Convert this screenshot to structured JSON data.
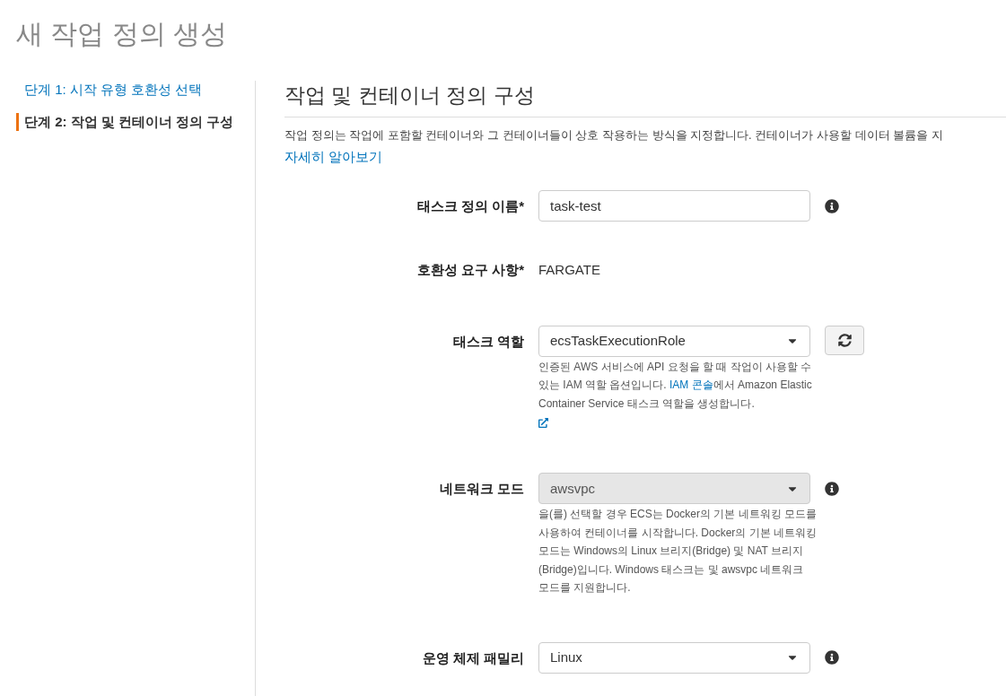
{
  "page_title": "새 작업 정의 생성",
  "steps": [
    {
      "label": "단계 1: 시작 유형 호환성 선택",
      "selected": false
    },
    {
      "label": "단계 2: 작업 및 컨테이너 정의 구성",
      "selected": true
    }
  ],
  "section": {
    "title": "작업 및 컨테이너 정의 구성",
    "description": "작업 정의는 작업에 포함할 컨테이너와 그 컨테이너들이 상호 작용하는 방식을 지정합니다. 컨테이너가 사용할 데이터 볼륨을 지",
    "link": "자세히 알아보기"
  },
  "fields": [
    {
      "kind": "text",
      "label": "태스크 정의 이름*",
      "value": "task-test",
      "info": true
    },
    {
      "kind": "static",
      "label": "호환성 요구 사항*",
      "value": "FARGATE",
      "info": false
    },
    {
      "kind": "select",
      "label": "태스크 역할",
      "value": "ecsTaskExecutionRole",
      "disabled": false,
      "refresh": true,
      "info": false,
      "help_before": "인증된 AWS 서비스에 API 요청을 할 때 작업이 사용할 수 있는 IAM 역할 옵션입니다. ",
      "help_link": "IAM 콘솔",
      "help_after": "에서 Amazon Elastic Container Service 태스크 역할을 생성합니다.",
      "external_link": true
    },
    {
      "kind": "select",
      "label": "네트워크 모드",
      "value": "awsvpc",
      "disabled": true,
      "refresh": false,
      "info": true,
      "help_before": "을(를) 선택할 경우 ECS는 Docker의 기본 네트워킹 모드를 사용하여 컨테이너를 시작합니다. Docker의 기본 네트워킹 모드는 Windows의 Linux 브리지(Bridge) 및 NAT 브리지(Bridge)입니다. Windows 태스크는 및 awsvpc 네트워크 모드를 지원합니다.",
      "external_link": false
    },
    {
      "kind": "select",
      "label": "운영 체제 패밀리",
      "value": "Linux",
      "disabled": false,
      "refresh": false,
      "info": true
    }
  ]
}
